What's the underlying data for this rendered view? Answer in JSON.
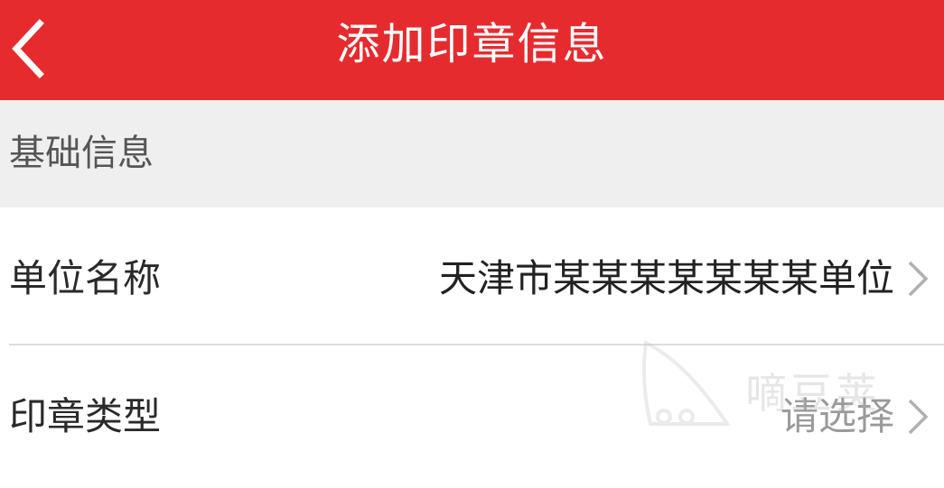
{
  "header": {
    "title": "添加印章信息",
    "background_color": "#e62b2f",
    "back_icon": "chevron-left-icon"
  },
  "section": {
    "title": "基础信息"
  },
  "form": {
    "rows": [
      {
        "label": "单位名称",
        "value": "天津市某某某某某某某单位",
        "icon": "chevron-right-icon"
      },
      {
        "label": "印章类型",
        "value": "请选择",
        "icon": "chevron-right-icon"
      }
    ]
  },
  "watermark": {
    "text": "嘀豆荚"
  }
}
